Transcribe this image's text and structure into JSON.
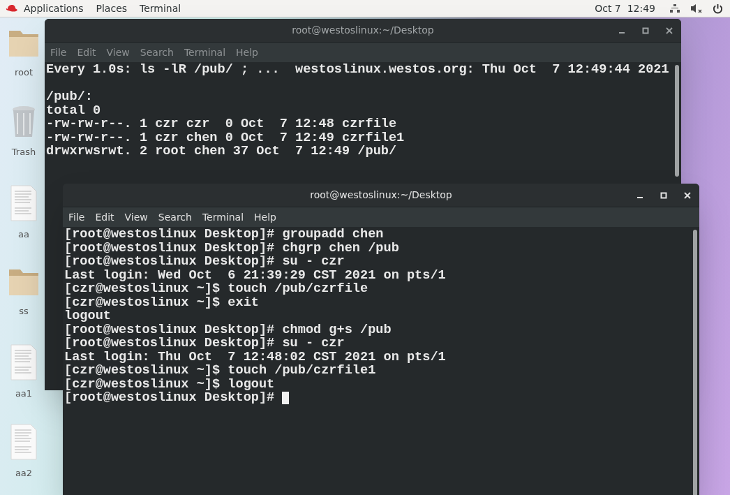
{
  "top_bar": {
    "menus": [
      "Applications",
      "Places",
      "Terminal"
    ],
    "clock": "Oct 7  12:49"
  },
  "desktop_icons": [
    {
      "kind": "folder",
      "label": "root"
    },
    {
      "kind": "trash",
      "label": "Trash"
    },
    {
      "kind": "document",
      "label": "aa"
    },
    {
      "kind": "folder",
      "label": "ss"
    },
    {
      "kind": "document",
      "label": "aa1"
    },
    {
      "kind": "document",
      "label": "aa2"
    }
  ],
  "windows": [
    {
      "title": "root@westoslinux:~/Desktop",
      "focused": false,
      "menu": [
        "File",
        "Edit",
        "View",
        "Search",
        "Terminal",
        "Help"
      ],
      "header": "Every 1.0s: ls -lR /pub/ ; ...  westoslinux.westos.org: Thu Oct  7 12:49:44 2021",
      "lines": [
        "/pub/:",
        "total 0",
        "-rw-rw-r--. 1 czr czr  0 Oct  7 12:48 czrfile",
        "-rw-rw-r--. 1 czr chen 0 Oct  7 12:49 czrfile1",
        "drwxrwsrwt. 2 root chen 37 Oct  7 12:49 /pub/"
      ]
    },
    {
      "title": "root@westoslinux:~/Desktop",
      "focused": true,
      "menu": [
        "File",
        "Edit",
        "View",
        "Search",
        "Terminal",
        "Help"
      ],
      "lines": [
        "[root@westoslinux Desktop]# groupadd chen",
        "[root@westoslinux Desktop]# chgrp chen /pub",
        "[root@westoslinux Desktop]# su - czr",
        "Last login: Wed Oct  6 21:39:29 CST 2021 on pts/1",
        "[czr@westoslinux ~]$ touch /pub/czrfile",
        "[czr@westoslinux ~]$ exit",
        "logout",
        "[root@westoslinux Desktop]# chmod g+s /pub",
        "[root@westoslinux Desktop]# su - czr",
        "Last login: Thu Oct  7 12:48:02 CST 2021 on pts/1",
        "[czr@westoslinux ~]$ touch /pub/czrfile1",
        "[czr@westoslinux ~]$ logout",
        "[root@westoslinux Desktop]# "
      ]
    }
  ]
}
